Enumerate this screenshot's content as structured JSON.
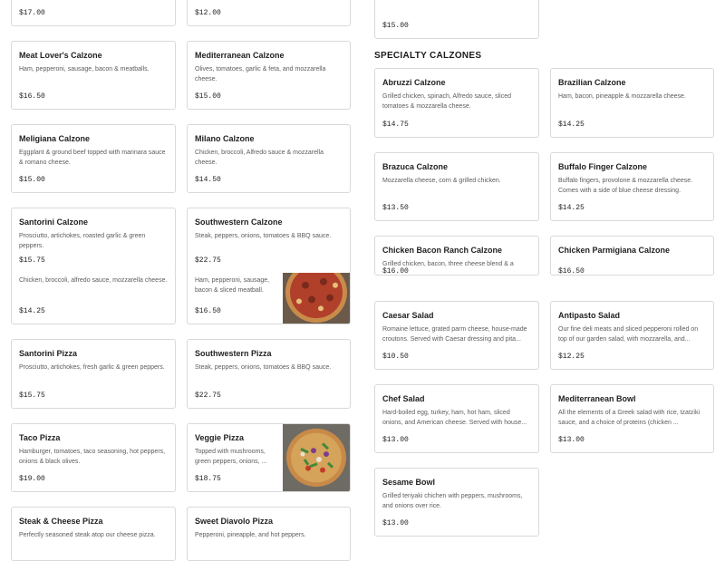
{
  "left_col": {
    "top_prices": [
      "$17.00",
      "$12.00"
    ],
    "cards": [
      {
        "name": "Meat Lover's Calzone",
        "desc": "Ham, pepperoni, sausage, bacon & meatballs.",
        "price": "$16.50"
      },
      {
        "name": "Mediterranean Calzone",
        "desc": "Olives, tomatoes, garlic & feta, and mozzarella cheese.",
        "price": "$15.00"
      },
      {
        "name": "Meligiana Calzone",
        "desc": "Eggplant & ground beef topped with marinara sauce & romano cheese.",
        "price": "$15.00"
      },
      {
        "name": "Milano Calzone",
        "desc": "Chicken, broccoli, Alfredo sauce & mozzarella cheese.",
        "price": "$14.50"
      },
      {
        "name": "Santorini Calzone",
        "desc": "Prosciutto, artichokes, roasted garlic & green peppers.",
        "price": "$15.75"
      },
      {
        "name": "Southwestern Calzone",
        "desc": "Steak, peppers, onions, tomatoes & BBQ sauce.",
        "price": "$22.75"
      },
      {
        "name": "",
        "desc": "Chicken, broccoli, alfredo sauce, mozzarella cheese.",
        "price": "$14.25"
      },
      {
        "name": "",
        "desc": "Ham, pepperoni, sausage, bacon & sliced meatball.",
        "price": "$16.50"
      },
      {
        "name": "Santorini Pizza",
        "desc": "Prosciutto, artichokes, fresh garlic & green peppers.",
        "price": "$15.75"
      },
      {
        "name": "Southwestern Pizza",
        "desc": "Steak, peppers, onions, tomatoes & BBQ sauce.",
        "price": "$22.75"
      },
      {
        "name": "Taco Pizza",
        "desc": "Hamburger, tomatoes, taco seasoning, hot peppers, onions & black olives.",
        "price": "$19.00"
      },
      {
        "name": "Veggie Pizza",
        "desc": "Topped with mushrooms, green peppers, onions, ...",
        "price": "$18.75"
      },
      {
        "name": "Steak & Cheese Pizza",
        "desc": "Perfectly seasoned steak atop our cheese pizza.",
        "price": ""
      },
      {
        "name": "Sweet Diavolo Pizza",
        "desc": "Pepperoni, pineapple, and hot peppers.",
        "price": ""
      }
    ]
  },
  "right_col": {
    "top_price": "$15.00",
    "section_title": "SPECIALTY CALZONES",
    "cards": [
      {
        "name": "Abruzzi Calzone",
        "desc": "Grilled chicken, spinach, Alfredo sauce, sliced tomatoes & mozzarella cheese.",
        "price": "$14.75"
      },
      {
        "name": "Brazilian Calzone",
        "desc": "Ham, bacon, pineapple & mozzarella cheese.",
        "price": "$14.25"
      },
      {
        "name": "Brazuca Calzone",
        "desc": "Mozzarella cheese, corn & grilled chicken.",
        "price": "$13.50"
      },
      {
        "name": "Buffalo Finger Calzone",
        "desc": "Buffalo fingers, provolone & mozzarella cheese. Comes with a side of blue cheese dressing.",
        "price": "$14.25"
      },
      {
        "name": "Chicken Bacon Ranch Calzone",
        "desc": "Grilled chicken, bacon, three cheese blend & a",
        "price": "$16.00"
      },
      {
        "name": "Chicken Parmigiana Calzone",
        "desc": "",
        "price": "$16.50"
      },
      {
        "name": "Caesar Salad",
        "desc": "Romaine lettuce, grated parm cheese, house-made croutons. Served with Caesar dressing and pita...",
        "price": "$10.50"
      },
      {
        "name": "Antipasto Salad",
        "desc": "Our fine deli meats and sliced pepperoni rolled on top of our garden salad, with mozzarella, and...",
        "price": "$12.25"
      },
      {
        "name": "Chef Salad",
        "desc": "Hard-boiled egg, turkey, ham, hot ham, sliced onions, and American cheese. Served with house...",
        "price": "$13.00"
      },
      {
        "name": "Mediterranean Bowl",
        "desc": "All the elements of a Greek salad with rice, tzatziki sauce, and a choice of proteins (chicken ...",
        "price": "$13.00"
      },
      {
        "name": "Sesame Bowl",
        "desc": "Grilled teriyaki chichen with peppers, mushrooms, and onions over rice.",
        "price": "$13.00"
      }
    ]
  }
}
